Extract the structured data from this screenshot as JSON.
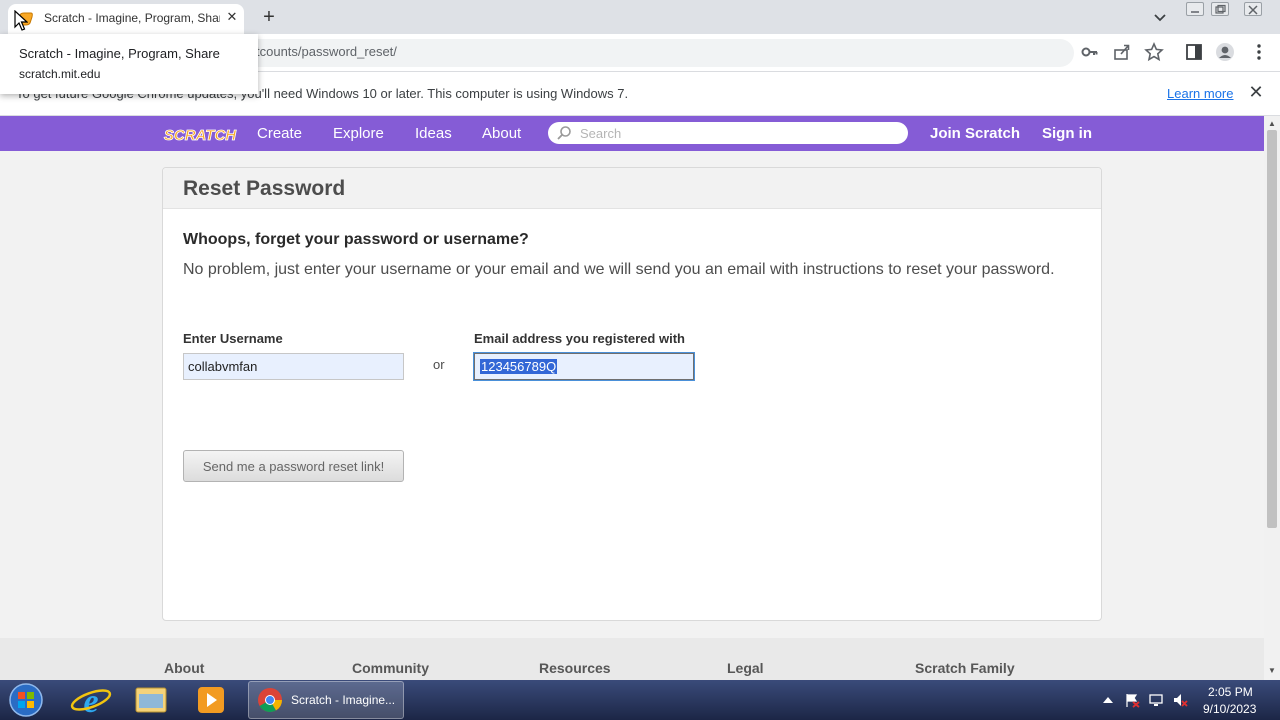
{
  "browser": {
    "tab_title": "Scratch - Imagine, Program, Share",
    "new_tab_label": "+",
    "tab_close_label": "✕",
    "url_partial": "tcounts/password_reset/",
    "tooltip": {
      "title": "Scratch - Imagine, Program, Share",
      "host": "scratch.mit.edu"
    },
    "infobar": {
      "text": "To get future Google Chrome updates, you'll need Windows 10 or later. This computer is using Windows 7.",
      "learn_more": "Learn more",
      "close_label": "✕"
    }
  },
  "nav": {
    "logo_text": "SCRATCH",
    "links": [
      "Create",
      "Explore",
      "Ideas",
      "About"
    ],
    "search_placeholder": "Search",
    "join": "Join Scratch",
    "sign_in": "Sign in"
  },
  "reset": {
    "title": "Reset Password",
    "heading": "Whoops, forget your password or username?",
    "description": "No problem, just enter your username or your email and we will send you an email with instructions to reset your password.",
    "username_label": "Enter Username",
    "username_value": "collabvmfan",
    "or_text": "or",
    "email_label": "Email address you registered with",
    "email_value": "123456789Q",
    "submit_label": "Send me a password reset link!"
  },
  "footer": {
    "headings": [
      "About",
      "Community",
      "Resources",
      "Legal",
      "Scratch Family"
    ]
  },
  "taskbar": {
    "chrome_label": "Scratch - Imagine...",
    "time": "2:05 PM",
    "date": "9/10/2023"
  },
  "colors": {
    "scratch_purple": "#855cd6",
    "link_blue": "#1a73e8",
    "selection_blue": "#3367d6"
  }
}
